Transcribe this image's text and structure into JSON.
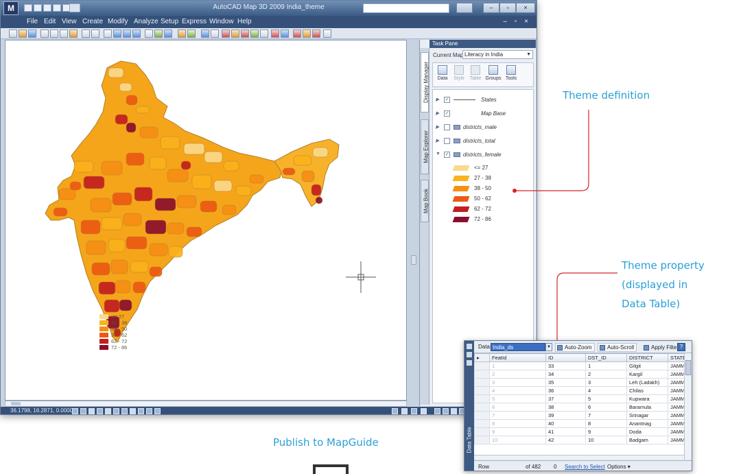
{
  "window": {
    "title": "AutoCAD Map 3D 2009 India_theme",
    "menu": [
      "File",
      "Edit",
      "View",
      "Create",
      "Modify",
      "Analyze",
      "Setup",
      "Express",
      "Window",
      "Help"
    ],
    "mdi_controls": "– ▫ ×",
    "logo": "M"
  },
  "status": {
    "coords": "36.1798, 16.2871, 0.0000"
  },
  "taskpane": {
    "header": "Task Pane",
    "current_map_label": "Current Map:",
    "current_map_value": "Literacy in India",
    "tabs": [
      "Display Manager",
      "Map Explorer",
      "Map Book"
    ],
    "tools": [
      {
        "label": "Data",
        "enabled": true
      },
      {
        "label": "Style",
        "enabled": false
      },
      {
        "label": "Table",
        "enabled": false
      },
      {
        "label": "Groups",
        "enabled": true
      },
      {
        "label": "Tools",
        "enabled": true
      }
    ],
    "layers": [
      {
        "name": "States",
        "checked": true,
        "expanded": false
      },
      {
        "name": "Map Base",
        "checked": true,
        "expanded": false
      },
      {
        "name": "districts_male",
        "checked": false,
        "expanded": false
      },
      {
        "name": "districts_total",
        "checked": false,
        "expanded": false
      },
      {
        "name": "districts_female",
        "checked": true,
        "expanded": true
      }
    ]
  },
  "theme_legend": [
    {
      "label": "<= 27",
      "color": "#fbd98a"
    },
    {
      "label": "27 - 38",
      "color": "#fbb21c"
    },
    {
      "label": "38 - 50",
      "color": "#f58f14"
    },
    {
      "label": "50 - 62",
      "color": "#ec5a12"
    },
    {
      "label": "62 - 72",
      "color": "#c41e1e"
    },
    {
      "label": "72 - 86",
      "color": "#8a0f2c"
    }
  ],
  "annotations": {
    "theme_definition": "Theme definition",
    "theme_property_1": "Theme property",
    "theme_property_2": "(displayed in",
    "theme_property_3": "Data Table)",
    "publish": "Publish to MapGuide",
    "colors": {
      "text": "#2b9fd6",
      "callout": "#d8232a"
    }
  },
  "datatable": {
    "side_label": "Data Table",
    "data_label": "Data:",
    "data_value": "India_ds",
    "buttons": {
      "auto_zoom": "Auto-Zoom",
      "auto_scroll": "Auto-Scroll",
      "apply_filter": "Apply Filter",
      "help": "?"
    },
    "columns": [
      "FeatId",
      "ID",
      "DST_ID",
      "DISTRICT",
      "STATE"
    ],
    "rows": [
      [
        "1",
        "33",
        "1",
        "Gilgit",
        "JAMMU A"
      ],
      [
        "2",
        "34",
        "2",
        "Kargil",
        "JAMMU A"
      ],
      [
        "3",
        "35",
        "3",
        "Leh (Ladakh)",
        "JAMMU A"
      ],
      [
        "4",
        "36",
        "4",
        "Chilas",
        "JAMMU A"
      ],
      [
        "5",
        "37",
        "5",
        "Kupwara",
        "JAMMU A"
      ],
      [
        "6",
        "38",
        "6",
        "Baramula",
        "JAMMU A"
      ],
      [
        "7",
        "39",
        "7",
        "Srinagar",
        "JAMMU A"
      ],
      [
        "8",
        "40",
        "8",
        "Anantnag",
        "JAMMU A"
      ],
      [
        "9",
        "41",
        "9",
        "Doda",
        "JAMMU A"
      ],
      [
        "10",
        "42",
        "10",
        "Badgam",
        "JAMMU A"
      ]
    ],
    "footer": {
      "row_label": "Row",
      "of_text": "of 482",
      "count": "0",
      "search": "Search to Select",
      "options": "Options ▾"
    }
  }
}
